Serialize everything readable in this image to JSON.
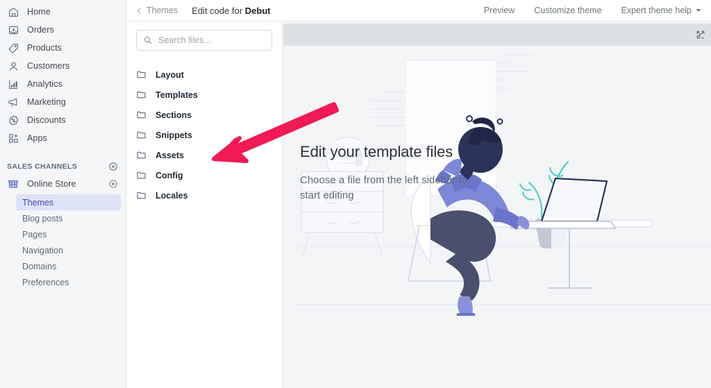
{
  "sidebar": {
    "items": [
      {
        "label": "Home",
        "icon": "home-icon"
      },
      {
        "label": "Orders",
        "icon": "orders-icon"
      },
      {
        "label": "Products",
        "icon": "products-tag-icon"
      },
      {
        "label": "Customers",
        "icon": "customers-person-icon"
      },
      {
        "label": "Analytics",
        "icon": "analytics-bar-chart-icon"
      },
      {
        "label": "Marketing",
        "icon": "marketing-megaphone-icon"
      },
      {
        "label": "Discounts",
        "icon": "discounts-badge-icon"
      },
      {
        "label": "Apps",
        "icon": "apps-grid-plus-icon"
      }
    ],
    "sales_channels_title": "SALES CHANNELS",
    "add_channel_icon": "plus-circle-icon",
    "channel": {
      "label": "Online Store",
      "icon": "online-store-icon",
      "view_icon": "eye-icon"
    },
    "sub_items": [
      {
        "label": "Themes",
        "active": true
      },
      {
        "label": "Blog posts",
        "active": false
      },
      {
        "label": "Pages",
        "active": false
      },
      {
        "label": "Navigation",
        "active": false
      },
      {
        "label": "Domains",
        "active": false
      },
      {
        "label": "Preferences",
        "active": false
      }
    ]
  },
  "topbar": {
    "back_icon": "chevron-left-icon",
    "breadcrumb": "Themes",
    "title_prefix": "Edit code for ",
    "title_theme": "Debut",
    "actions": [
      {
        "label": "Preview",
        "has_caret": false
      },
      {
        "label": "Customize theme",
        "has_caret": false
      },
      {
        "label": "Expert theme help",
        "has_caret": true
      }
    ]
  },
  "filepanel": {
    "search": {
      "placeholder": "Search files...",
      "value": "",
      "icon": "search-icon"
    },
    "folders": [
      {
        "label": "Layout"
      },
      {
        "label": "Templates"
      },
      {
        "label": "Sections"
      },
      {
        "label": "Snippets"
      },
      {
        "label": "Assets"
      },
      {
        "label": "Config"
      },
      {
        "label": "Locales"
      }
    ]
  },
  "content": {
    "toolbar": {
      "expand_icon": "expand-fullscreen-icon"
    },
    "empty_title": "Edit your template files",
    "empty_subtitle": "Choose a file from the left sidebar to start editing",
    "illustration_name": "person-at-desk-illustration"
  },
  "annotation": {
    "arrow_color": "#f01a55",
    "arrow_points_to": "Assets"
  },
  "colors": {
    "sidebar_bg": "#f4f6f8",
    "content_bg": "#f4f5f7",
    "toolbar_bg": "#dde1e6",
    "active_pill_bg": "#dfe3f7",
    "active_pill_text": "#3f4eae",
    "brand_purple": "#5c6ac4",
    "arrow_red": "#f01a55"
  }
}
